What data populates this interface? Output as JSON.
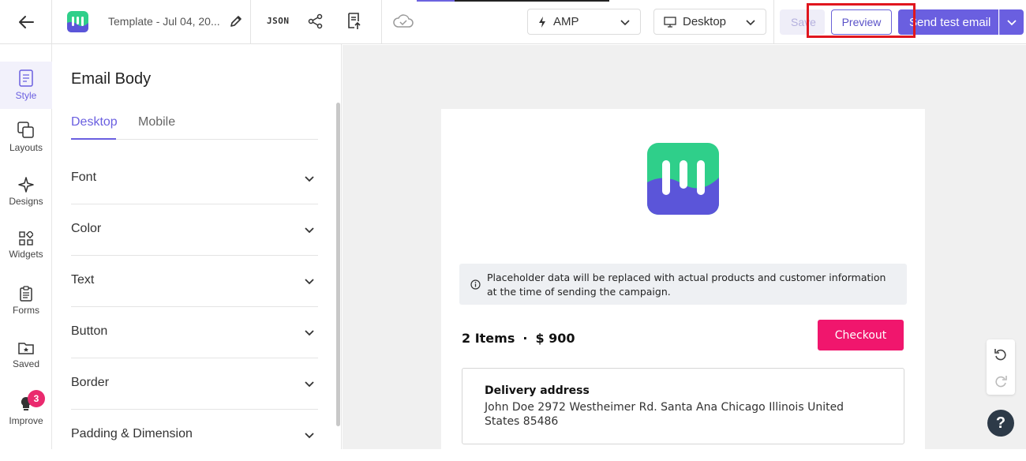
{
  "header": {
    "template_name": "Template - Jul 04, 20...",
    "json_label": "JSON",
    "amp_select": {
      "value": "AMP"
    },
    "device_select": {
      "value": "Desktop"
    },
    "save_label": "Save",
    "preview_label": "Preview",
    "send_label": "Send test email"
  },
  "rail": {
    "items": [
      {
        "label": "Style",
        "icon": "style-icon",
        "active": true
      },
      {
        "label": "Layouts",
        "icon": "layouts-icon"
      },
      {
        "label": "Designs",
        "icon": "designs-icon"
      },
      {
        "label": "Widgets",
        "icon": "widgets-icon"
      },
      {
        "label": "Forms",
        "icon": "forms-icon"
      },
      {
        "label": "Saved",
        "icon": "saved-icon"
      },
      {
        "label": "Improve",
        "icon": "lightbulb-icon",
        "badge": "3"
      }
    ]
  },
  "panel": {
    "title": "Email Body",
    "tabs": [
      {
        "label": "Desktop",
        "active": true
      },
      {
        "label": "Mobile"
      }
    ],
    "sections": [
      "Font",
      "Color",
      "Text",
      "Button",
      "Border",
      "Padding & Dimension"
    ]
  },
  "email": {
    "notice": "Placeholder data will be replaced with actual products and customer information at the time of sending the campaign.",
    "items_count": "2 Items",
    "separator": "·",
    "total": "$ 900",
    "checkout_label": "Checkout",
    "address_title": "Delivery address",
    "address_text": "John Doe 2972 Westheimer Rd. Santa Ana Chicago Illinois United States 85486"
  },
  "colors": {
    "accent": "#6a5fe0",
    "checkout": "#f0166d",
    "badge": "#ea2a6e",
    "logo_green": "#2fcf8a",
    "logo_purple": "#5b55d9",
    "highlight": "#e0161e"
  },
  "help_label": "?"
}
